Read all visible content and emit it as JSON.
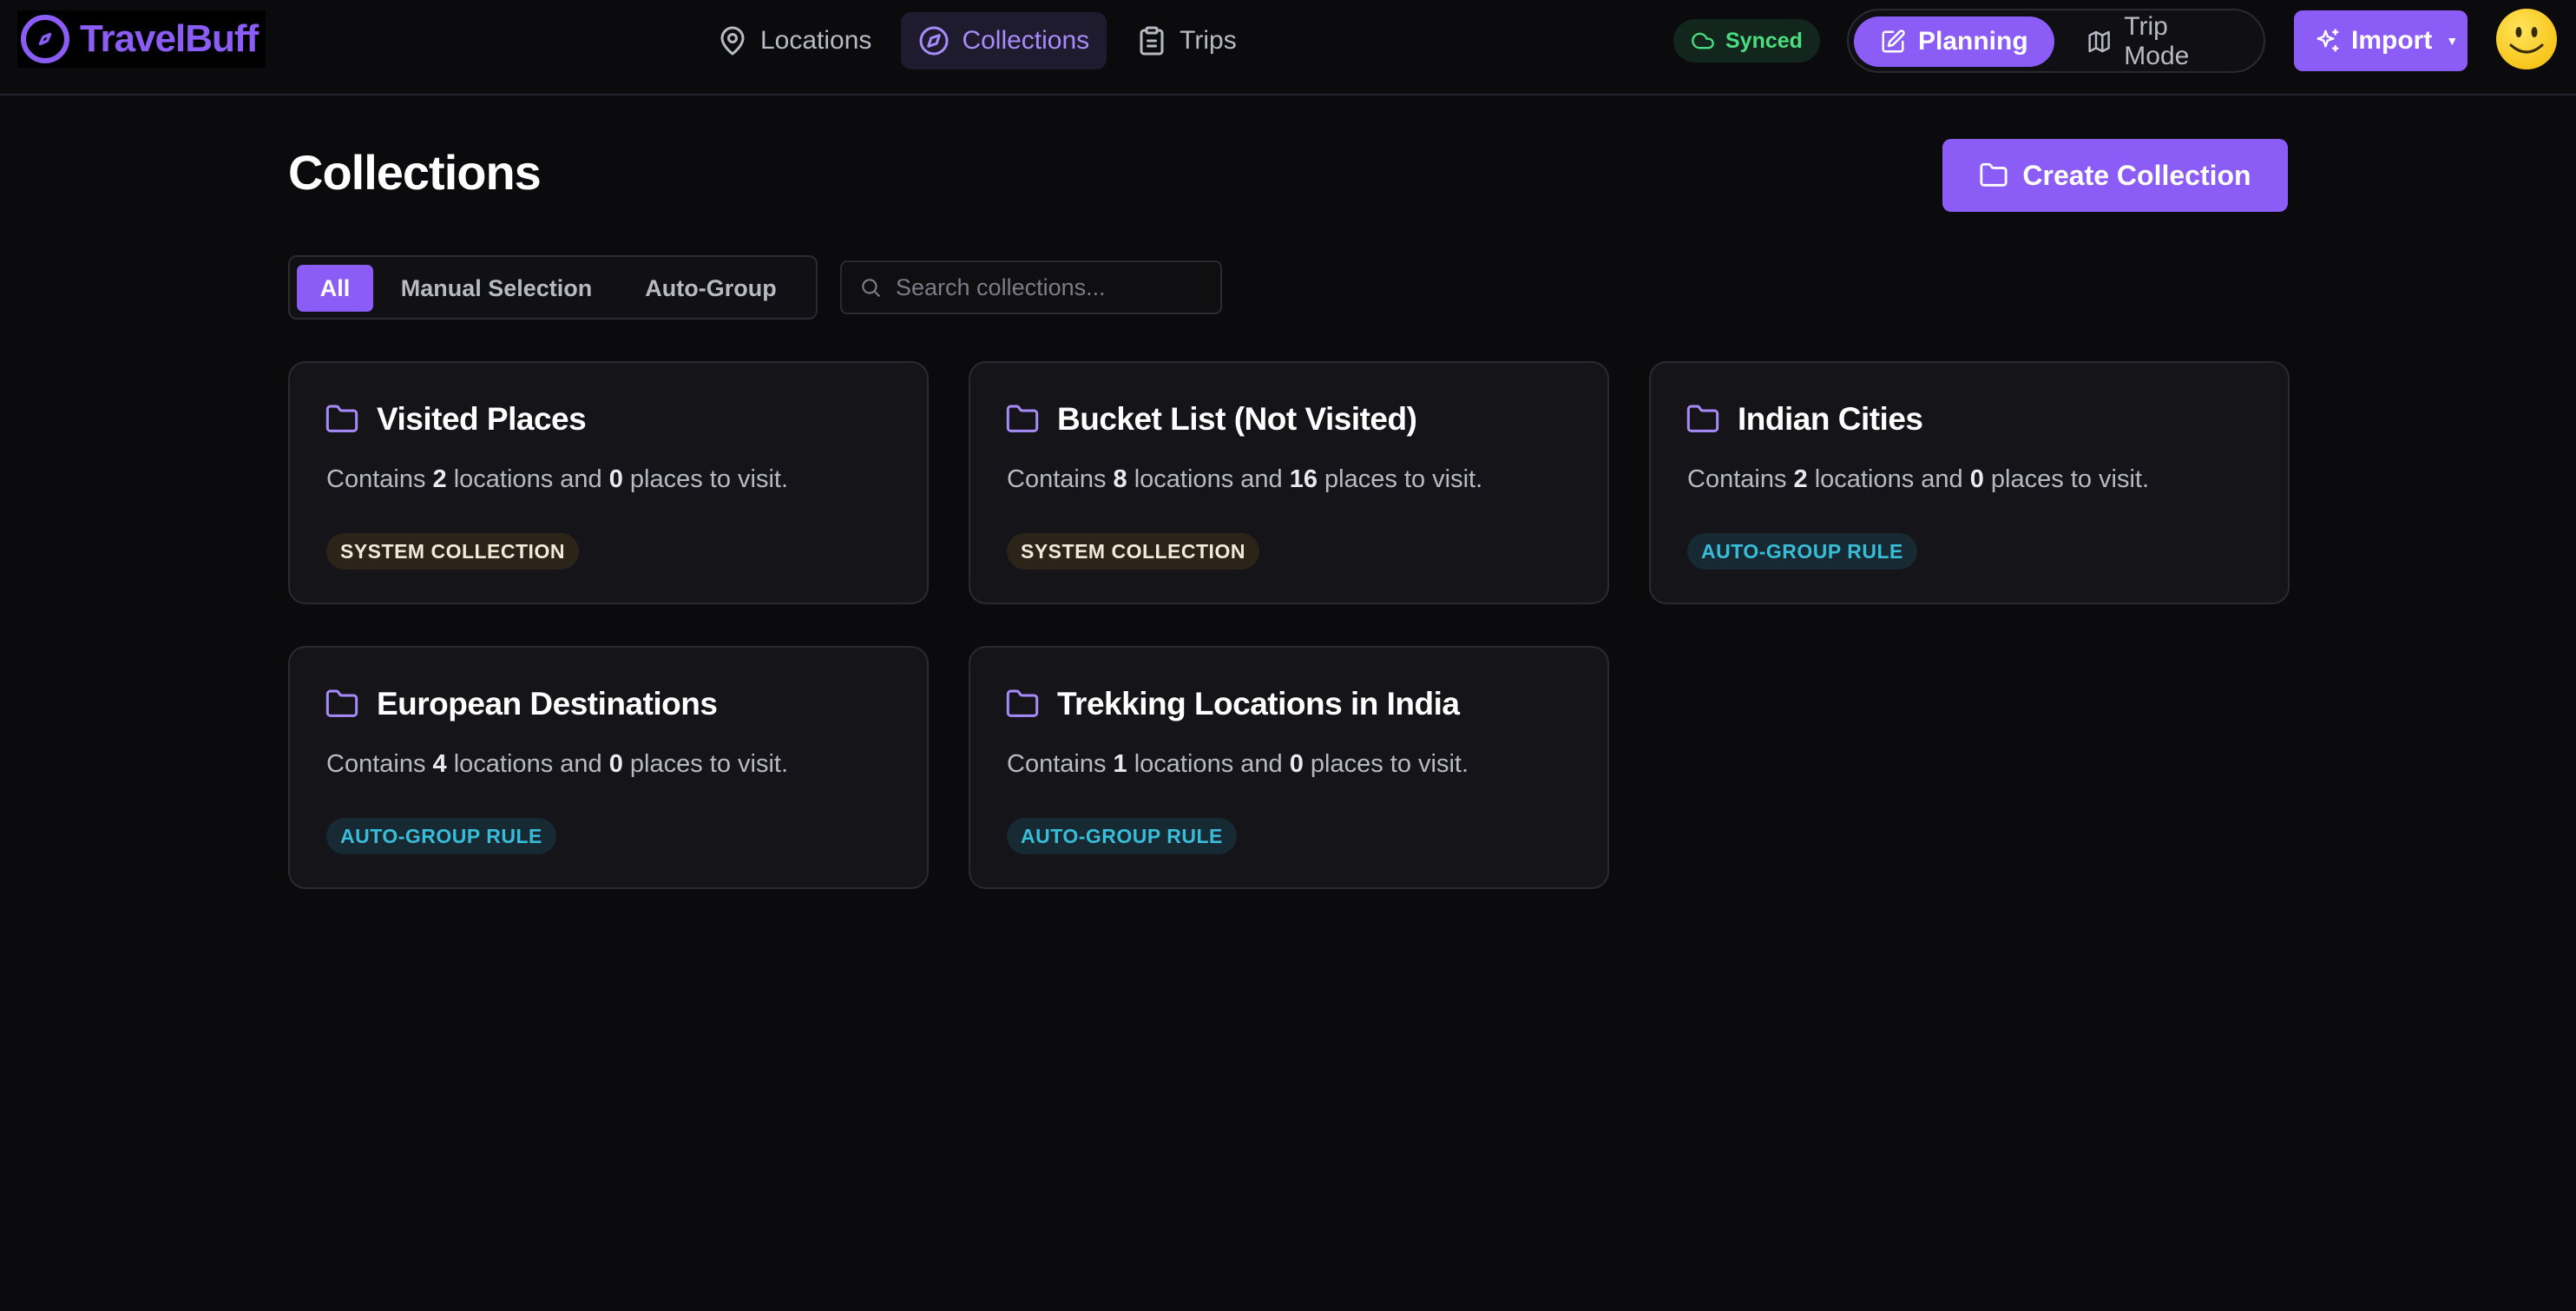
{
  "app": {
    "name": "TravelBuff"
  },
  "nav": {
    "items": [
      {
        "label": "Locations",
        "icon": "map-pin-icon"
      },
      {
        "label": "Collections",
        "icon": "compass-icon",
        "active": true
      },
      {
        "label": "Trips",
        "icon": "clipboard-icon"
      }
    ]
  },
  "status": {
    "synced_label": "Synced"
  },
  "mode": {
    "planning_label": "Planning",
    "trip_label": "Trip Mode",
    "active": "Planning"
  },
  "import": {
    "label": "Import"
  },
  "page": {
    "title": "Collections",
    "create_label": "Create Collection"
  },
  "filters": {
    "all": "All",
    "manual": "Manual Selection",
    "auto": "Auto-Group",
    "active": "All"
  },
  "search": {
    "placeholder": "Search collections...",
    "value": ""
  },
  "card_text": {
    "prefix": "Contains",
    "middle": "locations and",
    "suffix": "places to visit."
  },
  "collections": [
    {
      "title": "Visited Places",
      "locations": "2",
      "places": "0",
      "badge": "SYSTEM COLLECTION"
    },
    {
      "title": "Bucket List (Not Visited)",
      "locations": "8",
      "places": "16",
      "badge": "SYSTEM COLLECTION"
    },
    {
      "title": "Indian Cities",
      "locations": "2",
      "places": "0",
      "badge": "AUTO-GROUP RULE"
    },
    {
      "title": "European Destinations",
      "locations": "4",
      "places": "0",
      "badge": "AUTO-GROUP RULE"
    },
    {
      "title": "Trekking Locations in India",
      "locations": "1",
      "places": "0",
      "badge": "AUTO-GROUP RULE"
    }
  ],
  "colors": {
    "accent": "#8b5cf6",
    "synced": "#4ade80",
    "auto_badge": "#38bdd8",
    "system_badge_bg": "#2d2419"
  }
}
